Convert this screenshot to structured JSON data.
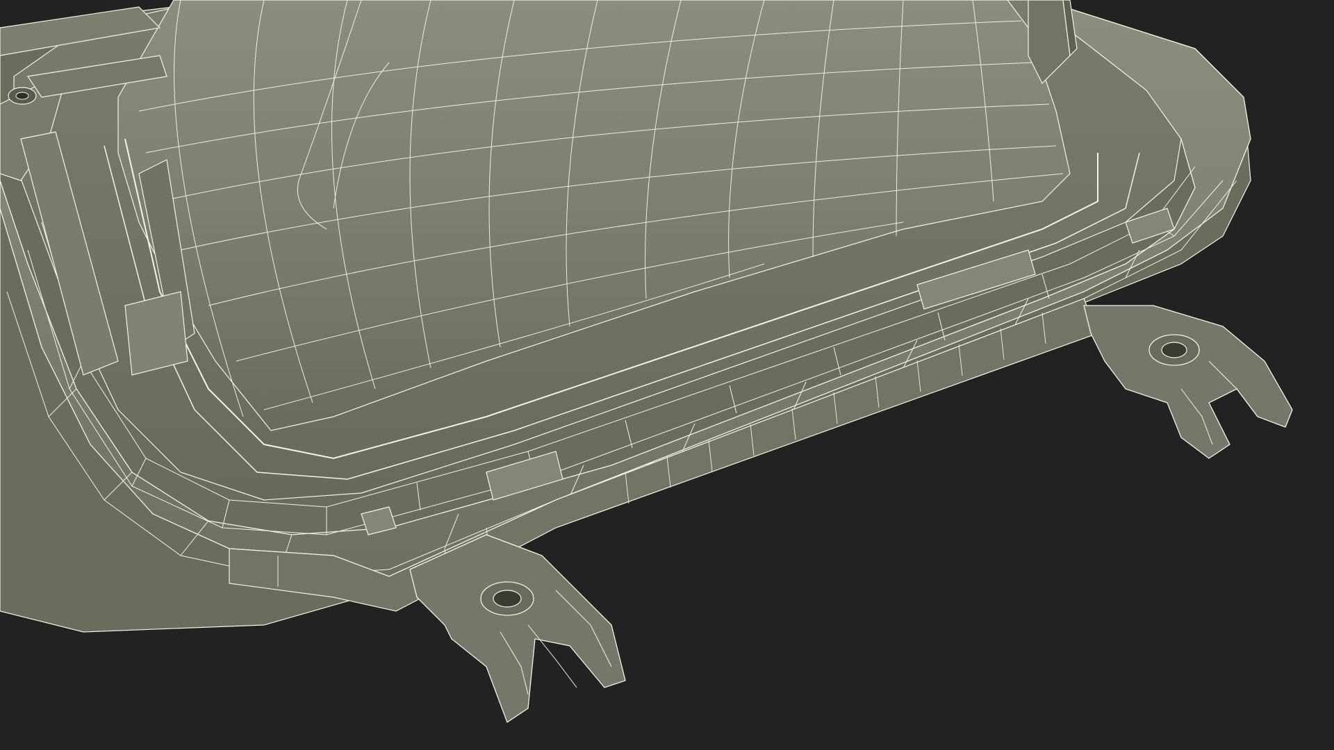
{
  "scene": {
    "background_color": "#222222",
    "surface_color": "#7e7f70",
    "surface_shadow_color": "#55564b",
    "surface_highlight_color": "#9a9b8b",
    "wire_color": "#f4f4e4",
    "subject": "wireframe-3d-model-render"
  }
}
